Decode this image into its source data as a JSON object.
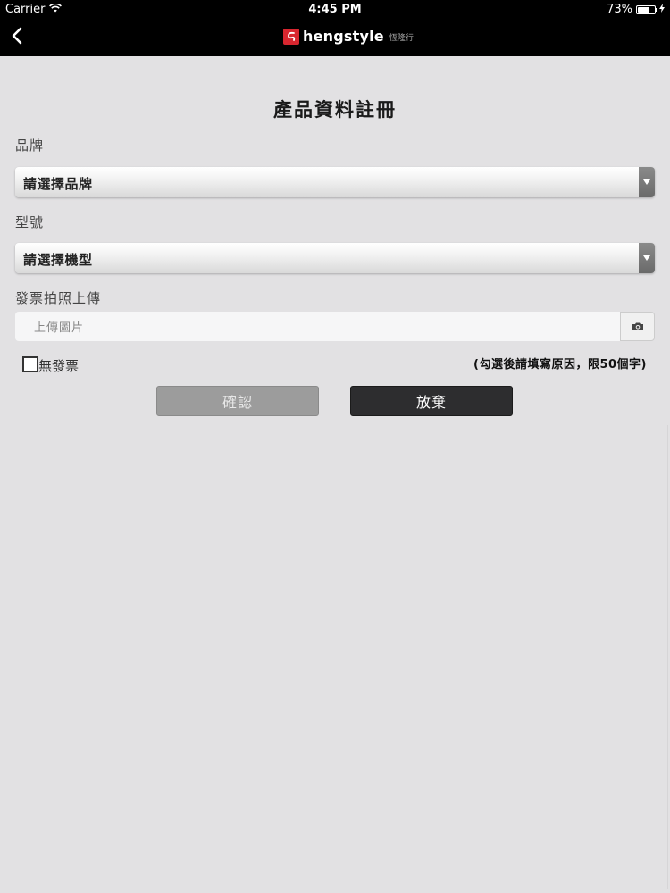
{
  "status_bar": {
    "carrier": "Carrier",
    "time": "4:45 PM",
    "battery_percent": "73%",
    "battery_level": 0.73,
    "wifi_icon": "wifi-icon",
    "charging_icon": "lightning-icon"
  },
  "nav": {
    "back_icon": "chevron-left-icon",
    "logo_text": "hengstyle",
    "logo_sub": "恆隆行"
  },
  "form": {
    "title": "產品資料註冊",
    "brand_label": "品牌",
    "brand_select": "請選擇品牌",
    "model_label": "型號",
    "model_select": "請選擇機型",
    "upload_label": "發票拍照上傳",
    "upload_placeholder": "上傳圖片",
    "camera_icon": "camera-icon",
    "no_invoice_label": "無發票",
    "no_invoice_checked": false,
    "note": "(勾選後請填寫原因，限50個字)",
    "confirm_button": "確認",
    "cancel_button": "放棄"
  },
  "colors": {
    "background": "#e2e1e3",
    "nav_bar": "#000000",
    "brand_red": "#d8262f",
    "confirm_button": "#9c9c9c",
    "cancel_button": "#2d2d2f"
  }
}
